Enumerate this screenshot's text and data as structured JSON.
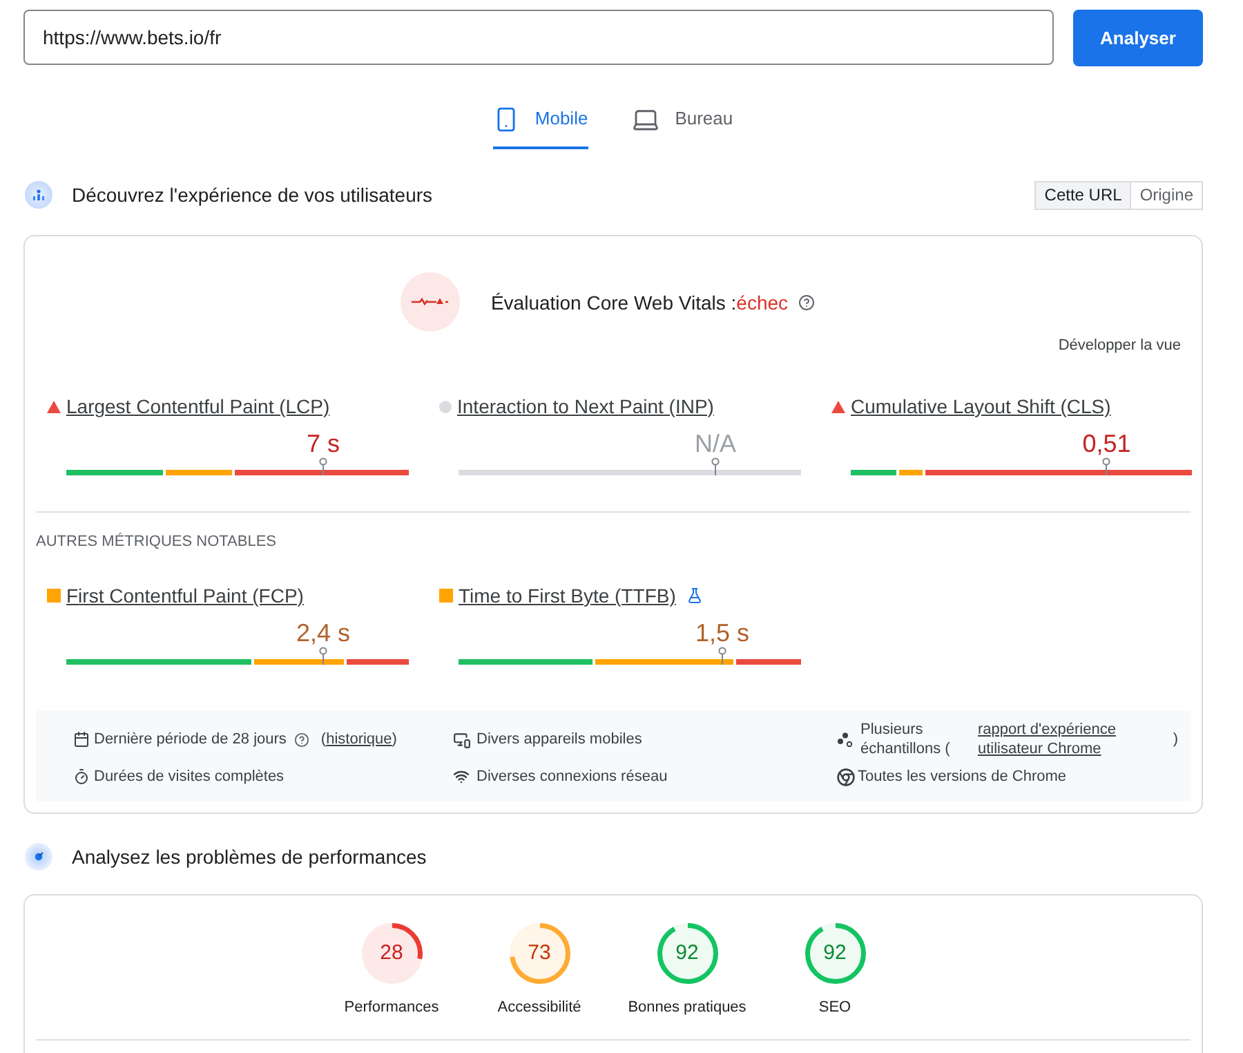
{
  "search": {
    "value": "https://www.bets.io/fr"
  },
  "analyze_button": "Analyser",
  "tabs": [
    {
      "label": "Mobile",
      "selected": true
    },
    {
      "label": "Bureau",
      "selected": false
    }
  ],
  "field_section": {
    "title": "Découvrez l'expérience de vos utilisateurs",
    "scope_toggle": [
      {
        "label": "Cette URL",
        "selected": true
      },
      {
        "label": "Origine",
        "selected": false
      }
    ],
    "assessment": {
      "title": "Évaluation Core Web Vitals :",
      "status": "échec",
      "passed": false
    },
    "expand_link": "Développer la vue",
    "core_metrics": [
      {
        "title": "Largest Contentful Paint (LCP)",
        "kind": "poor",
        "value": "7 s",
        "experimental": false,
        "level": 0.75,
        "track": {
          "kind": "poor",
          "segments": [
            {
              "kind": "good",
              "level": 0.29
            },
            {
              "kind": "average",
              "level": 0.49
            }
          ]
        }
      },
      {
        "title": "Interaction to Next Paint (INP)",
        "kind": "none",
        "value": "N/A",
        "experimental": false,
        "level": 0.75,
        "track": {
          "kind": "none"
        }
      },
      {
        "title": "Cumulative Layout Shift (CLS)",
        "kind": "poor",
        "value": "0,51",
        "experimental": false,
        "level": 0.75,
        "track": {
          "kind": "poor",
          "segments": [
            {
              "kind": "good",
              "level": 0.14
            },
            {
              "kind": "average",
              "level": 0.22
            }
          ]
        }
      }
    ],
    "other_heading": "AUTRES MÉTRIQUES NOTABLES",
    "other_metrics": [
      {
        "title": "First Contentful Paint (FCP)",
        "kind": "average",
        "value": "2,4 s",
        "experimental": false,
        "level": 0.75,
        "track": {
          "kind": "poor",
          "segments": [
            {
              "kind": "good",
              "level": 0.55
            },
            {
              "kind": "average",
              "level": 0.82
            }
          ]
        }
      },
      {
        "title": "Time to First Byte (TTFB)",
        "kind": "average",
        "value": "1,5 s",
        "experimental": true,
        "level": 0.77,
        "track": {
          "kind": "poor",
          "segments": [
            {
              "kind": "good",
              "level": 0.4
            },
            {
              "kind": "average",
              "level": 0.81
            }
          ]
        }
      }
    ],
    "details": {
      "period": "Dernière période de 28 jours",
      "history_open": "(",
      "history_link": "historique",
      "history_close": ")",
      "devices": "Divers appareils mobiles",
      "samples": "Plusieurs échantillons (",
      "samples_link": "rapport d'expérience utilisateur Chrome",
      "samples_close": ")",
      "duration": "Durées de visites complètes",
      "network": "Diverses connexions réseau",
      "versions": "Toutes les versions de Chrome"
    }
  },
  "lab_section": {
    "title": "Analysez les problèmes de performances",
    "gauges": [
      {
        "score": "28",
        "label": "Performances",
        "kind": "poor"
      },
      {
        "score": "73",
        "label": "Accessibilité",
        "kind": "average"
      },
      {
        "score": "92",
        "label": "Bonnes pratiques",
        "kind": "good"
      },
      {
        "score": "92",
        "label": "SEO",
        "kind": "good"
      }
    ]
  }
}
